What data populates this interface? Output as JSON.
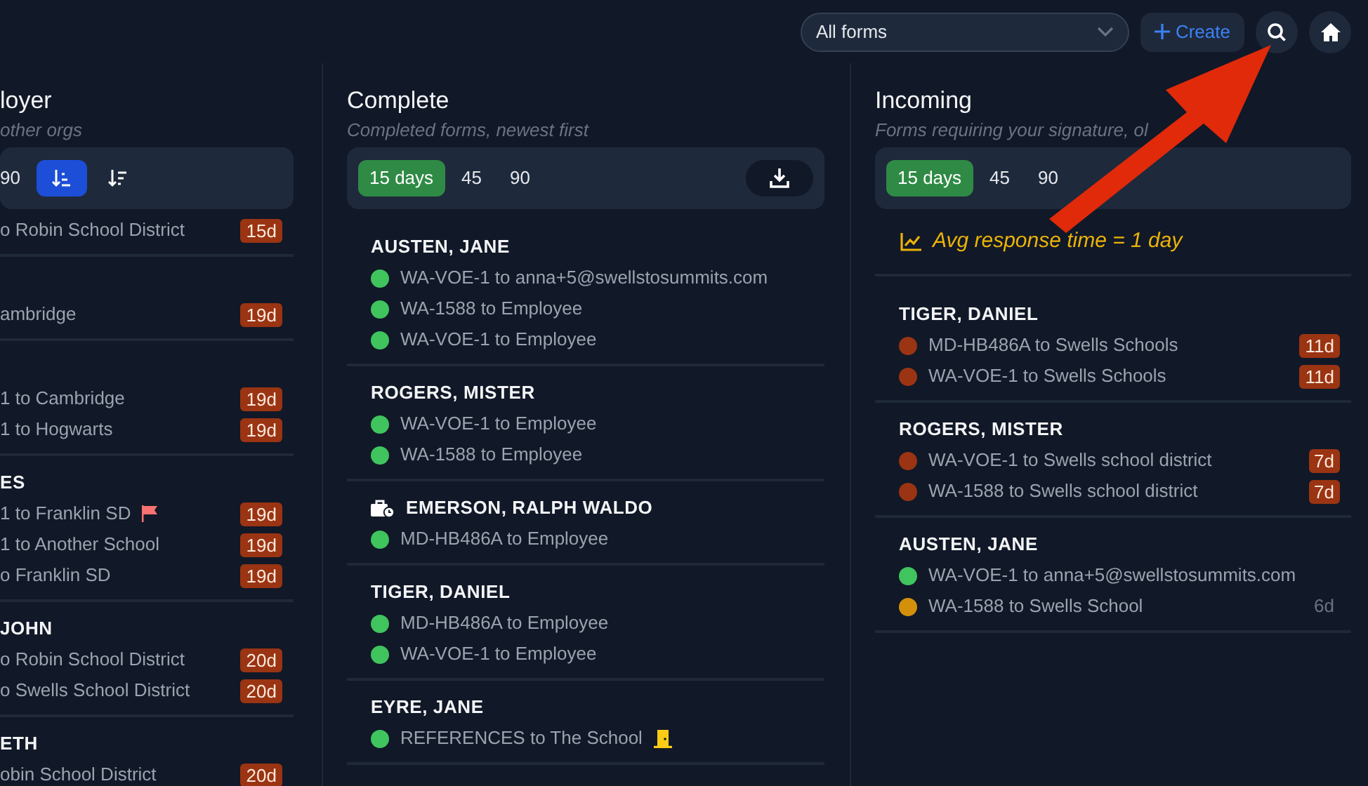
{
  "toolbar": {
    "form_filter": {
      "value": "All forms"
    },
    "create_label": "Create"
  },
  "columns": [
    {
      "title": "loyer",
      "subtitle": "other orgs",
      "filters": [
        {
          "label": "90",
          "selected": false
        }
      ],
      "sort_buttons": [
        {
          "selected": true
        },
        {
          "selected": false
        }
      ],
      "groups": [
        {
          "items": [
            {
              "text": "o Robin School District",
              "badge": "15d",
              "overdue": true
            }
          ]
        },
        {
          "items": [
            {
              "text": "ambridge",
              "badge": "19d",
              "overdue": true
            }
          ]
        },
        {
          "items": [
            {
              "text": "1 to Cambridge",
              "badge": "19d",
              "overdue": true
            },
            {
              "text": "1 to Hogwarts",
              "badge": "19d",
              "overdue": true
            }
          ]
        },
        {
          "name": "ES",
          "items": [
            {
              "text": "1 to Franklin SD",
              "flagged": true,
              "badge": "19d",
              "overdue": true
            },
            {
              "text": "1 to Another School",
              "badge": "19d",
              "overdue": true
            },
            {
              "text": "o Franklin SD",
              "badge": "19d",
              "overdue": true
            }
          ]
        },
        {
          "name": "JOHN",
          "items": [
            {
              "text": "o Robin School District",
              "badge": "20d",
              "overdue": true
            },
            {
              "text": "o Swells School District",
              "badge": "20d",
              "overdue": true
            }
          ]
        },
        {
          "name": "ETH",
          "items": [
            {
              "text": "obin School District",
              "badge": "20d",
              "overdue": true
            }
          ]
        }
      ]
    },
    {
      "title": "Complete",
      "subtitle": "Completed forms, newest first",
      "filters": [
        {
          "label": "15 days",
          "selected": true
        },
        {
          "label": "45",
          "selected": false
        },
        {
          "label": "90",
          "selected": false
        }
      ],
      "download": true,
      "groups": [
        {
          "name": "AUSTEN, JANE",
          "items": [
            {
              "text": "WA-VOE-1 to anna+5@swellstosummits.com",
              "color": "#3fc45e"
            },
            {
              "text": "WA-1588 to Employee",
              "color": "#3fc45e"
            },
            {
              "text": "WA-VOE-1 to Employee",
              "color": "#3fc45e"
            }
          ]
        },
        {
          "name": "ROGERS, MISTER",
          "items": [
            {
              "text": "WA-VOE-1 to Employee",
              "color": "#3fc45e"
            },
            {
              "text": "WA-1588 to Employee",
              "color": "#3fc45e"
            }
          ]
        },
        {
          "name": "EMERSON, RALPH WALDO",
          "kind": "briefcase",
          "items": [
            {
              "text": "MD-HB486A to Employee",
              "color": "#3fc45e"
            }
          ]
        },
        {
          "name": "TIGER, DANIEL",
          "items": [
            {
              "text": "MD-HB486A to Employee",
              "color": "#3fc45e"
            },
            {
              "text": "WA-VOE-1 to Employee",
              "color": "#3fc45e"
            }
          ]
        },
        {
          "name": "EYRE, JANE",
          "items": [
            {
              "text": "REFERENCES to The School",
              "color": "#3fc45e",
              "door": true
            }
          ]
        }
      ]
    },
    {
      "title": "Incoming",
      "subtitle": "Forms requiring your signature, ol",
      "filters": [
        {
          "label": "15 days",
          "selected": true
        },
        {
          "label": "45",
          "selected": false
        },
        {
          "label": "90",
          "selected": false
        }
      ],
      "avg_response": "Avg response time = 1 day",
      "groups": [
        {
          "name": "TIGER, DANIEL",
          "items": [
            {
              "text": "MD-HB486A to Swells Schools",
              "color": "#9a3412",
              "badge": "11d",
              "overdue": true
            },
            {
              "text": "WA-VOE-1 to Swells Schools",
              "color": "#9a3412",
              "badge": "11d",
              "overdue": true
            }
          ]
        },
        {
          "name": "ROGERS, MISTER",
          "items": [
            {
              "text": "WA-VOE-1 to Swells school district",
              "color": "#9a3412",
              "badge": "7d",
              "overdue": true
            },
            {
              "text": "WA-1588 to Swells school district",
              "color": "#9a3412",
              "badge": "7d",
              "overdue": true
            }
          ]
        },
        {
          "name": "AUSTEN, JANE",
          "items": [
            {
              "text": "WA-VOE-1 to anna+5@swellstosummits.com",
              "color": "#3fc45e"
            },
            {
              "text": "WA-1588 to Swells School",
              "color": "#d4900b",
              "badge": "6d",
              "overdue": false
            }
          ]
        }
      ]
    }
  ]
}
